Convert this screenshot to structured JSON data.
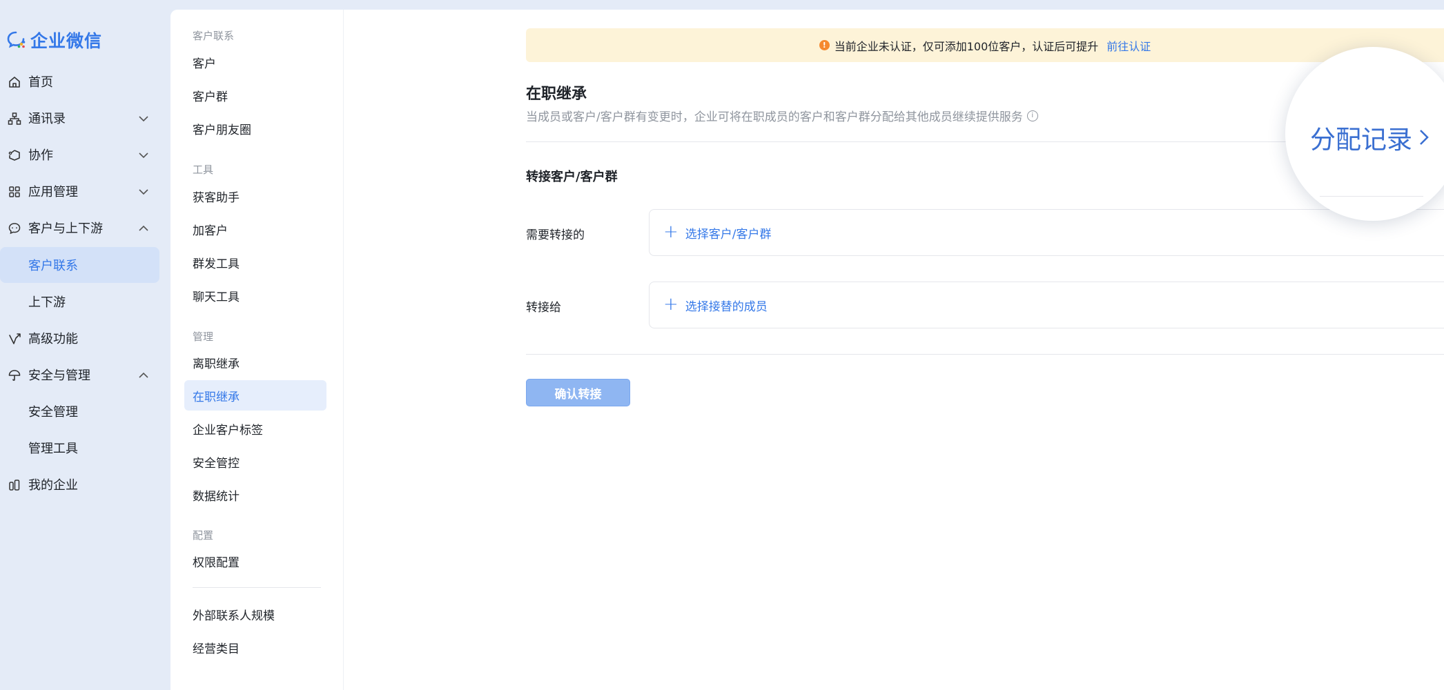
{
  "app": {
    "name": "企业微信",
    "brand_color": "#3478e8"
  },
  "nav": {
    "items": [
      {
        "key": "home",
        "label": "首页",
        "icon": "home-icon"
      },
      {
        "key": "contacts",
        "label": "通讯录",
        "icon": "org-icon",
        "expand": "chevron-down-icon"
      },
      {
        "key": "collab",
        "label": "协作",
        "icon": "collab-icon",
        "expand": "chevron-down-icon"
      },
      {
        "key": "apps",
        "label": "应用管理",
        "icon": "apps-grid-icon",
        "expand": "chevron-down-icon"
      },
      {
        "key": "customers",
        "label": "客户与上下游",
        "icon": "chat-bubble-icon",
        "expand": "chevron-up-icon"
      },
      {
        "key": "customer-contact",
        "label": "客户联系"
      },
      {
        "key": "upstream",
        "label": "上下游"
      },
      {
        "key": "advanced",
        "label": "高级功能",
        "icon": "advanced-icon"
      },
      {
        "key": "security",
        "label": "安全与管理",
        "icon": "umbrella-icon",
        "expand": "chevron-up-icon"
      },
      {
        "key": "security-mgmt",
        "label": "安全管理"
      },
      {
        "key": "mgmt-tools",
        "label": "管理工具"
      },
      {
        "key": "my-company",
        "label": "我的企业",
        "icon": "building-icon"
      }
    ]
  },
  "subnav": {
    "sections": {
      "contact": "客户联系",
      "tools": "工具",
      "manage": "管理",
      "config": "配置"
    },
    "items": {
      "customer": "客户",
      "customer_group": "客户群",
      "moments": "客户朋友圈",
      "acquire": "获客助手",
      "add_customer": "加客户",
      "mass_send": "群发工具",
      "chat_tools": "聊天工具",
      "resigned": "离职继承",
      "onjob": "在职继承",
      "tags": "企业客户标签",
      "safety": "安全管控",
      "stats": "数据统计",
      "permissions": "权限配置",
      "scale": "外部联系人规模",
      "category": "经营类目"
    }
  },
  "banner": {
    "text": "当前企业未认证，仅可添加100位客户，认证后可提升",
    "link": "前往认证",
    "icon": "warning-icon"
  },
  "main": {
    "title": "在职继承",
    "description": "当成员或客户/客户群有变更时，企业可将在职成员的客户和客户群分配给其他成员继续提供服务",
    "section_title": "转接客户/客户群",
    "transfer_from_label": "需要转接的",
    "transfer_from_action": "选择客户/客户群",
    "transfer_to_label": "转接给",
    "transfer_to_action": "选择接替的成员",
    "confirm_button": "确认转接",
    "records_link": "分配记录"
  }
}
